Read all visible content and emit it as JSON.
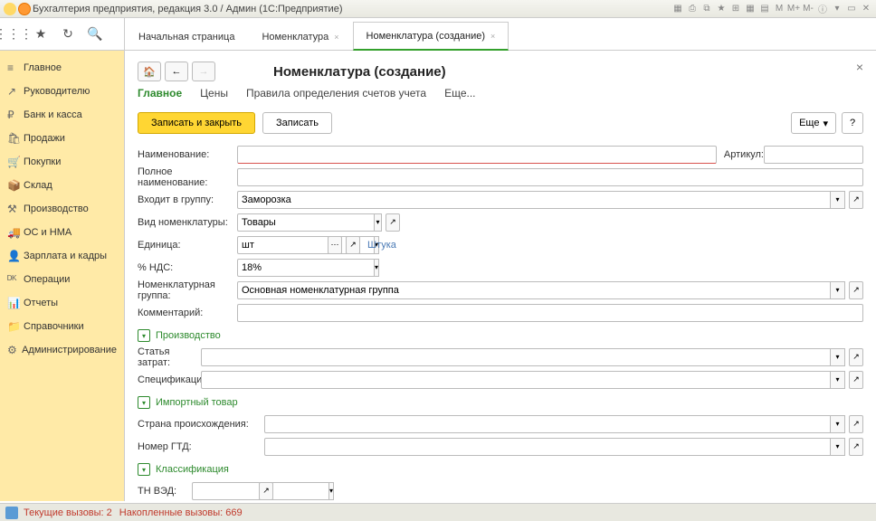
{
  "titlebar": {
    "text": "Бухгалтерия предприятия, редакция 3.0 / Админ (1С:Предприятие)",
    "rbtns": [
      "▦",
      "⎙",
      "⧉",
      "★",
      "⊞",
      "▦",
      "▤",
      "M",
      "M+",
      "M-",
      "ⓘ",
      "▾",
      "▭",
      "✕"
    ]
  },
  "tabs": {
    "start": "Начальная страница",
    "nom": "Номенклатура",
    "create": "Номенклатура (создание)"
  },
  "side": [
    {
      "ic": "≡",
      "t": "Главное"
    },
    {
      "ic": "↗",
      "t": "Руководителю"
    },
    {
      "ic": "₽",
      "t": "Банк и касса"
    },
    {
      "ic": "🛍",
      "t": "Продажи"
    },
    {
      "ic": "🛒",
      "t": "Покупки"
    },
    {
      "ic": "📦",
      "t": "Склад"
    },
    {
      "ic": "⚒",
      "t": "Производство"
    },
    {
      "ic": "🚚",
      "t": "ОС и НМА"
    },
    {
      "ic": "👤",
      "t": "Зарплата и кадры"
    },
    {
      "ic": "ᴰᴷ",
      "t": "Операции"
    },
    {
      "ic": "📊",
      "t": "Отчеты"
    },
    {
      "ic": "📁",
      "t": "Справочники"
    },
    {
      "ic": "⚙",
      "t": "Администрирование"
    }
  ],
  "page": {
    "title": "Номенклатура (создание)",
    "subtabs": {
      "main": "Главное",
      "prices": "Цены",
      "rules": "Правила определения счетов учета",
      "more": "Еще..."
    },
    "save_close": "Записать и закрыть",
    "save": "Записать",
    "more": "Еще",
    "labels": {
      "name": "Наименование:",
      "artikul": "Артикул:",
      "fullname": "Полное наименование:",
      "group": "Входит в группу:",
      "kind": "Вид номенклатуры:",
      "unit": "Единица:",
      "unit_hint": "Штука",
      "vat": "% НДС:",
      "nomgrp": "Номенклатурная группа:",
      "comment": "Комментарий:",
      "prod": "Производство",
      "cost": "Статья затрат:",
      "spec": "Спецификация:",
      "imp": "Импортный товар",
      "country": "Страна происхождения:",
      "gtd": "Номер ГТД:",
      "class": "Классификация",
      "tnved": "ТН ВЭД:"
    },
    "values": {
      "group": "Заморозка",
      "kind": "Товары",
      "unit": "шт",
      "vat": "18%",
      "nomgrp": "Основная номенклатурная группа"
    }
  },
  "status": {
    "t1": "Текущие вызовы: 2",
    "t2": "Накопленные вызовы: 669"
  }
}
